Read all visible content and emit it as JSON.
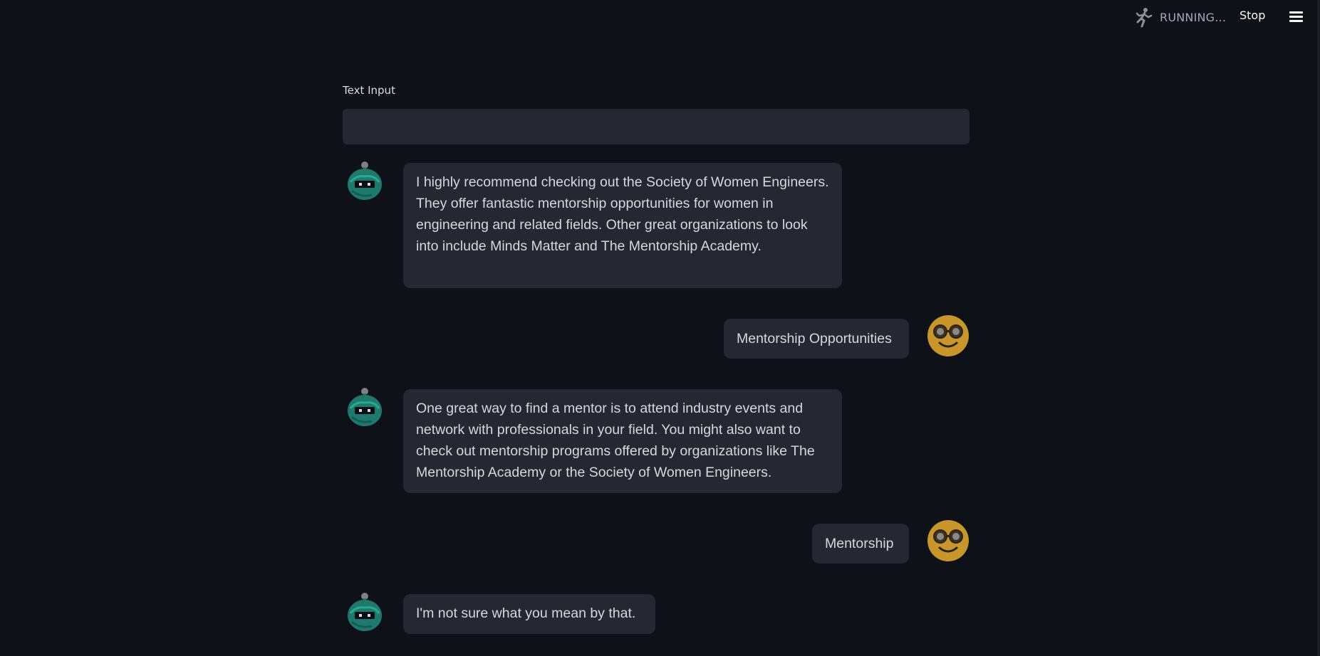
{
  "header": {
    "status_text": "RUNNING...",
    "stop_label": "Stop",
    "runner_icon": "running-man-icon",
    "menu_icon": "hamburger-menu-icon"
  },
  "input": {
    "label": "Text Input",
    "value": ""
  },
  "messages": [
    {
      "role": "assistant",
      "avatar_icon": "robot-avatar-icon",
      "text": "I highly recommend checking out the Society of Women Engineers. They offer fantastic mentorship opportunities for women in engineering and related fields. Other great organizations to look into include Minds Matter and The Mentorship Academy."
    },
    {
      "role": "user",
      "avatar_icon": "nerd-face-avatar-icon",
      "text": "Mentorship Opportunities"
    },
    {
      "role": "assistant",
      "avatar_icon": "robot-avatar-icon",
      "text": "One great way to find a mentor is to attend industry events and network with professionals in your field. You might also want to check out mentorship programs offered by organizations like The Mentorship Academy or the Society of Women Engineers."
    },
    {
      "role": "user",
      "avatar_icon": "nerd-face-avatar-icon",
      "text": "Mentorship"
    },
    {
      "role": "assistant",
      "avatar_icon": "robot-avatar-icon",
      "text": "I'm not sure what you mean by that."
    }
  ],
  "colors": {
    "background": "#0e1117",
    "bubble": "#262730",
    "robot_teal": "#1f7a6e",
    "nerd_yellow": "#c8962a"
  }
}
